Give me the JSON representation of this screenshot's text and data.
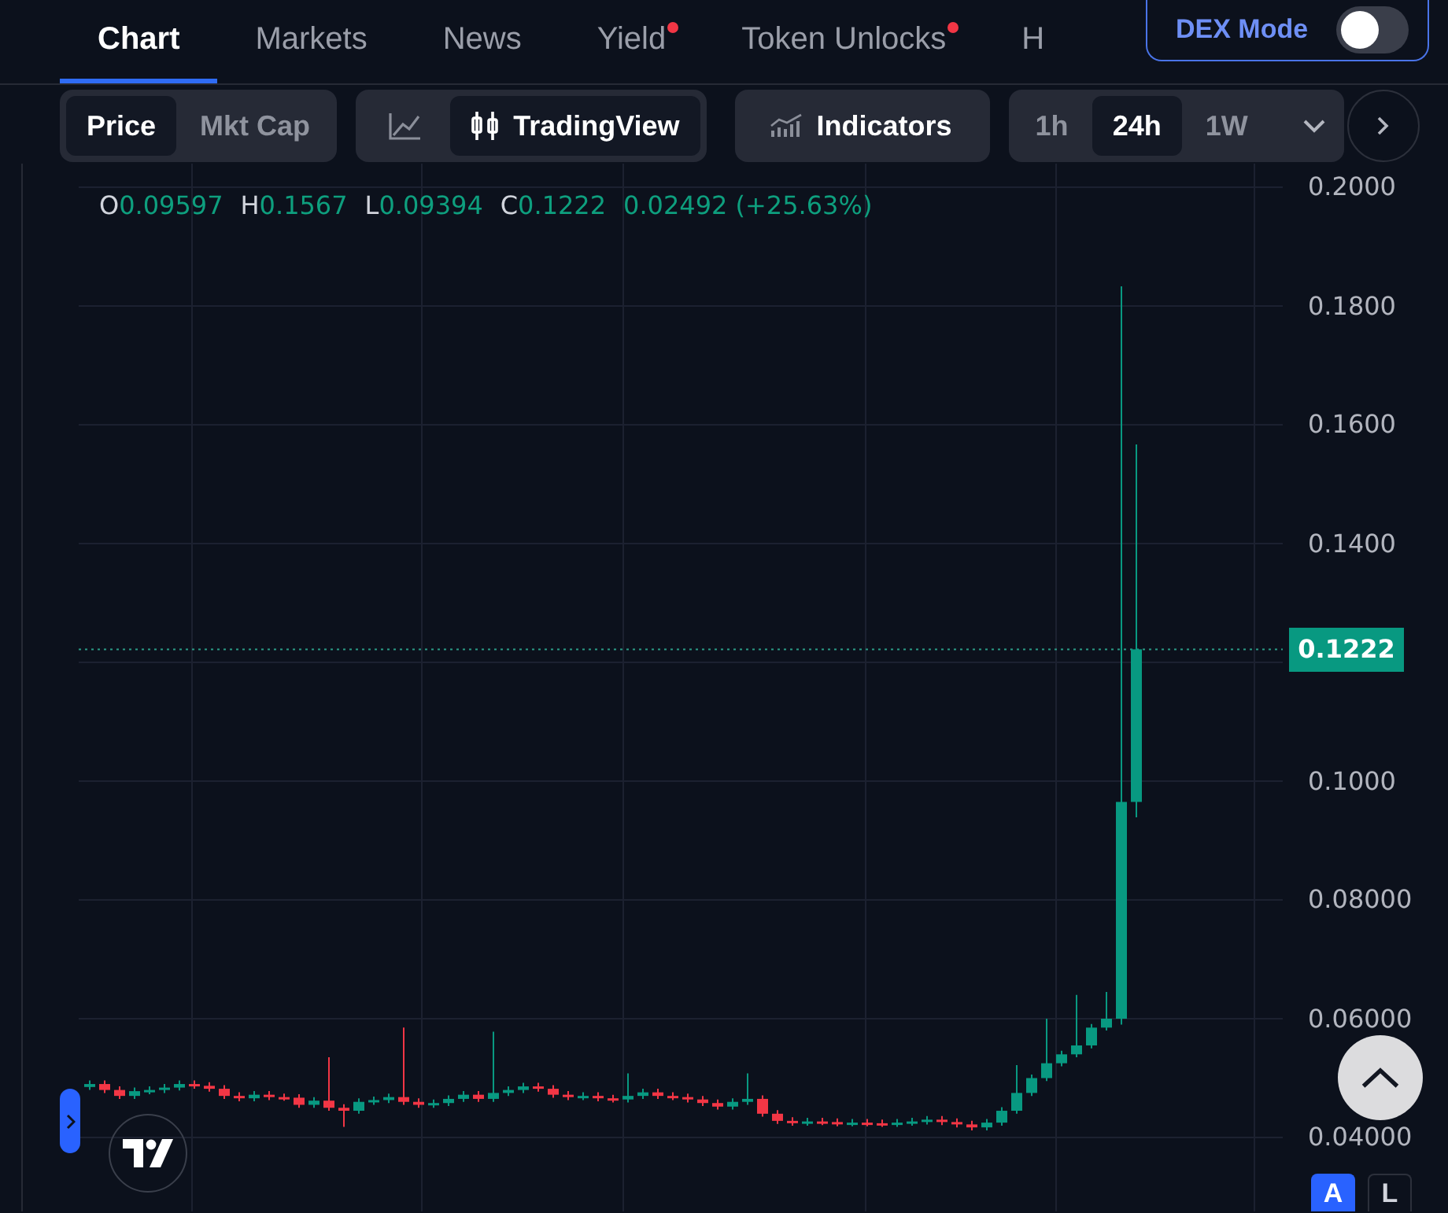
{
  "tabs": [
    {
      "label": "Chart",
      "selected": true,
      "dot": false
    },
    {
      "label": "Markets",
      "selected": false,
      "dot": false
    },
    {
      "label": "News",
      "selected": false,
      "dot": false
    },
    {
      "label": "Yield",
      "selected": false,
      "dot": true
    },
    {
      "label": "Token Unlocks",
      "selected": false,
      "dot": true
    },
    {
      "label": "H",
      "selected": false,
      "dot": false
    }
  ],
  "dex_mode": {
    "label": "DEX Mode",
    "on": false
  },
  "toolbar": {
    "metric": [
      {
        "label": "Price",
        "selected": true
      },
      {
        "label": "Mkt Cap",
        "selected": false
      }
    ],
    "chart_type": [
      {
        "kind": "line",
        "selected": false
      },
      {
        "kind": "candles",
        "label": "TradingView",
        "selected": true
      }
    ],
    "indicators": "Indicators",
    "intervals": [
      {
        "label": "1h",
        "selected": false
      },
      {
        "label": "24h",
        "selected": true
      },
      {
        "label": "1W",
        "selected": false
      }
    ]
  },
  "legend": [
    {
      "key": "O",
      "value": "0.09597"
    },
    {
      "key": "H",
      "value": "0.1567"
    },
    {
      "key": "L",
      "value": "0.09394"
    },
    {
      "key": "C",
      "value": "0.1222"
    }
  ],
  "legend_change": "0.02492 (+25.63%)",
  "price_axis": [
    "0.2000",
    "0.1800",
    "0.1600",
    "0.1400",
    "0.1000",
    "0.08000",
    "0.06000",
    "0.04000"
  ],
  "last_price": "0.1222",
  "scale_buttons": [
    {
      "label": "A",
      "selected": true
    },
    {
      "label": "L",
      "selected": false
    }
  ]
}
